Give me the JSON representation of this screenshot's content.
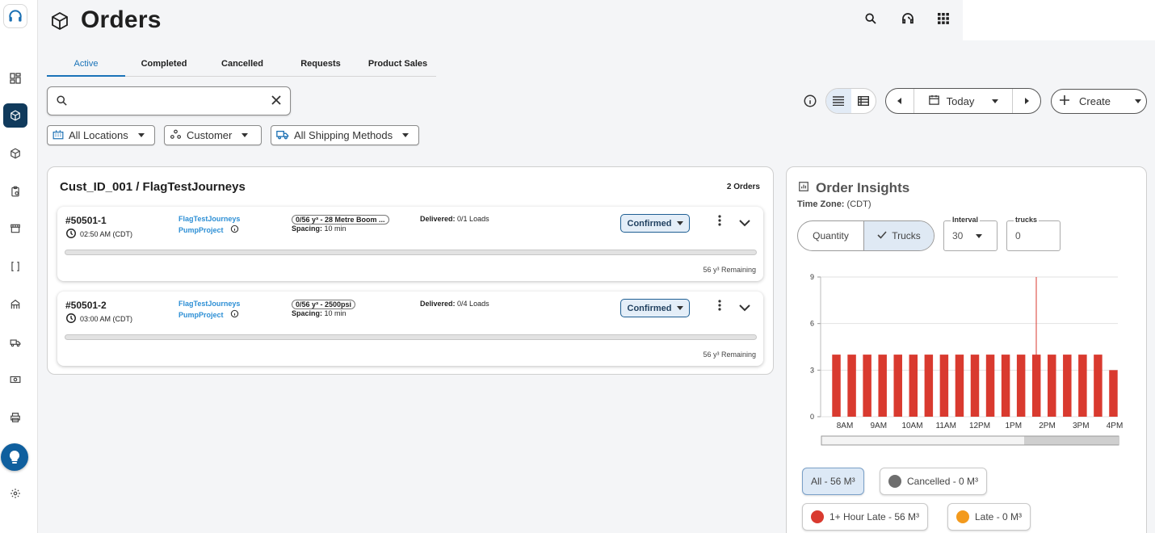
{
  "page": {
    "title": "Orders"
  },
  "sidebar": {
    "items": [
      {
        "name": "dashboard"
      },
      {
        "name": "orders",
        "active": true
      },
      {
        "name": "products"
      },
      {
        "name": "clipboard"
      },
      {
        "name": "store"
      },
      {
        "name": "brackets"
      },
      {
        "name": "plant"
      },
      {
        "name": "truck"
      },
      {
        "name": "money"
      },
      {
        "name": "printer"
      }
    ],
    "lightbulb": "lightbulb-icon",
    "settings": "gear-icon"
  },
  "tabs": [
    {
      "label": "Active",
      "active": true
    },
    {
      "label": "Completed"
    },
    {
      "label": "Cancelled"
    },
    {
      "label": "Requests"
    },
    {
      "label": "Product Sales"
    }
  ],
  "search": {
    "value": "",
    "placeholder": ""
  },
  "filters": {
    "locations": "All Locations",
    "customer": "Customer",
    "shipping": "All Shipping Methods"
  },
  "date_nav": {
    "label": "Today"
  },
  "create_label": "Create",
  "orders": {
    "customer_title": "Cust_ID_001 / FlagTestJourneys",
    "count_label": "2 Orders",
    "items": [
      {
        "id": "#50501-1",
        "time": "02:50 AM (CDT)",
        "customer": "FlagTestJourneys",
        "project": "PumpProject",
        "mix": "0/56 y³ - 28 Metre Boom ...",
        "spacing_label": "Spacing:",
        "spacing_value": "10 min",
        "delivered_label": "Delivered:",
        "delivered_value": "0/1 Loads",
        "status": "Confirmed",
        "progress": 0,
        "remaining": "56 y³ Remaining"
      },
      {
        "id": "#50501-2",
        "time": "03:00 AM (CDT)",
        "customer": "FlagTestJourneys",
        "project": "PumpProject",
        "mix": "0/56 y³ - 2500psi",
        "spacing_label": "Spacing:",
        "spacing_value": "10 min",
        "delivered_label": "Delivered:",
        "delivered_value": "0/4 Loads",
        "status": "Confirmed",
        "progress": 0,
        "remaining": "56 y³ Remaining"
      }
    ]
  },
  "insights": {
    "title": "Order Insights",
    "tz_label": "Time Zone:",
    "tz_value": "(CDT)",
    "toggle": {
      "quantity": "Quantity",
      "trucks": "Trucks",
      "selected": "trucks"
    },
    "interval_label": "Interval",
    "interval_value": "30",
    "trucks_label": "trucks",
    "trucks_value": "0",
    "legend": {
      "all": "All - 56 M³",
      "cancelled": "Cancelled - 0 M³",
      "hour_late": "1+ Hour Late - 56 M³",
      "late": "Late - 0 M³"
    },
    "colors": {
      "bar": "#d93a2f",
      "cancelled": "#6e6e6e",
      "hour_late": "#d93a2f",
      "late": "#f39a1d",
      "now_line": "#d93a2f"
    }
  },
  "chart_data": {
    "type": "bar",
    "y_ticks": [
      "0",
      "3",
      "6",
      "9"
    ],
    "ylim": [
      0,
      9
    ],
    "x_tick_labels": [
      "8AM",
      "9AM",
      "10AM",
      "11AM",
      "12PM",
      "1PM",
      "2PM",
      "3PM",
      "4PM"
    ],
    "values": [
      4,
      4,
      4,
      4,
      4,
      4,
      4,
      4,
      4,
      4,
      4,
      4,
      4,
      4,
      4,
      4,
      4,
      4,
      3
    ],
    "grid": true
  }
}
